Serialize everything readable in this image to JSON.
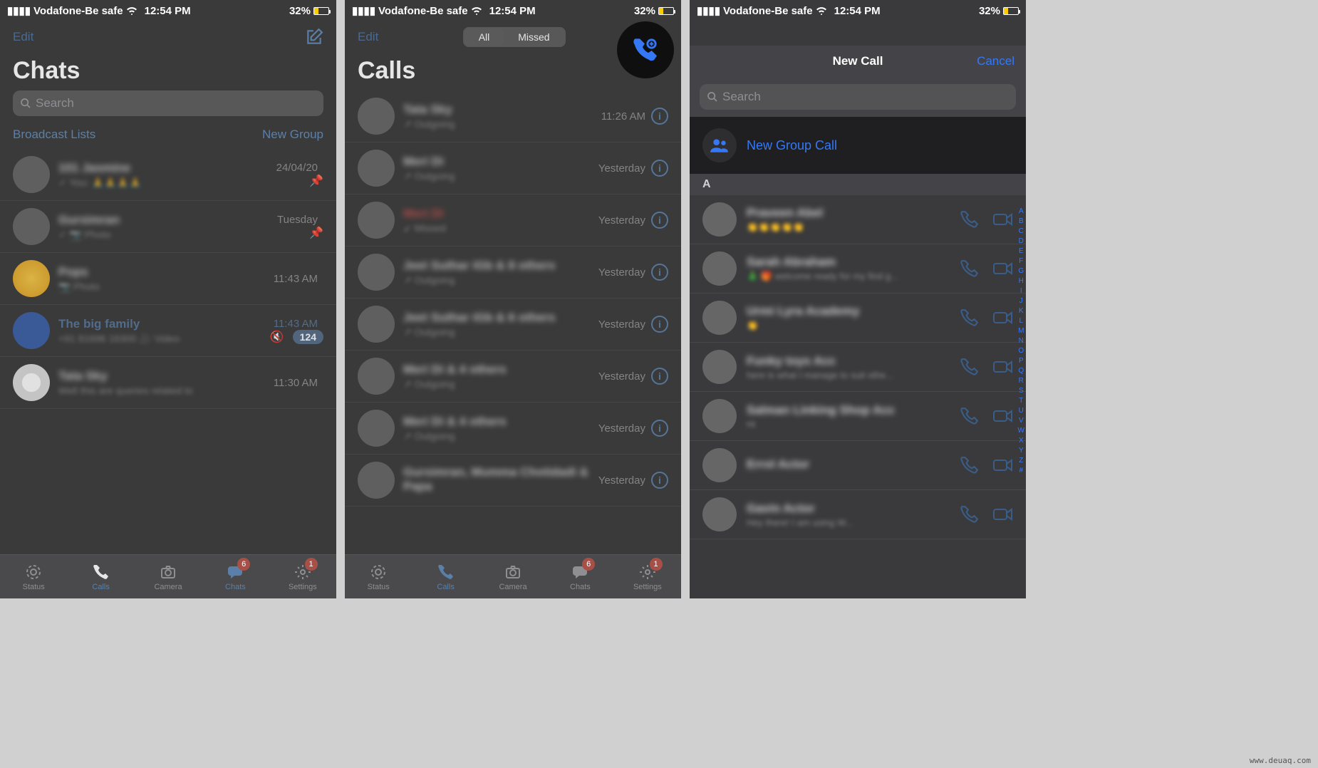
{
  "status": {
    "carrier": "Vodafone-Be safe",
    "time": "12:54 PM",
    "battery_pct": "32%"
  },
  "screen1": {
    "edit": "Edit",
    "title": "Chats",
    "search_ph": "Search",
    "broadcast": "Broadcast Lists",
    "newgroup": "New Group",
    "chats": [
      {
        "name": "101 Jasmine",
        "sub": "✓ You: 🙏🙏🙏🙏",
        "time": "24/04/20",
        "pinned": true
      },
      {
        "name": "Gursimran",
        "sub": "✓ 📷 Photo",
        "time": "Tuesday",
        "pinned": true
      },
      {
        "name": "Pops",
        "sub": "📷 Photo",
        "time": "11:43 AM"
      },
      {
        "name": "The big family",
        "sub": "+91 81696 16300  🎥 Video",
        "time": "11:43 AM",
        "muted": true,
        "badge": "124"
      },
      {
        "name": "Tata Sky",
        "sub": "Well this are queries related to",
        "time": "11:30 AM"
      }
    ],
    "tabs": {
      "status": "Status",
      "calls": "Calls",
      "camera": "Camera",
      "chats": "Chats",
      "settings": "Settings",
      "chats_badge": "6",
      "settings_badge": "1"
    }
  },
  "screen2": {
    "edit": "Edit",
    "title": "Calls",
    "seg_all": "All",
    "seg_missed": "Missed",
    "calls": [
      {
        "name": "Tata Sky",
        "sub": "↗ Outgoing",
        "time": "11:26 AM"
      },
      {
        "name": "Meri Di",
        "sub": "↗ Outgoing",
        "time": "Yesterday"
      },
      {
        "name": "Meri Di",
        "sub": "↙ Missed",
        "time": "Yesterday",
        "missed": true
      },
      {
        "name": "Jeet Suthar iGb & 8 others",
        "sub": "↗ Outgoing",
        "time": "Yesterday"
      },
      {
        "name": "Jeet Suthar iGb & 6 others",
        "sub": "↗ Outgoing",
        "time": "Yesterday"
      },
      {
        "name": "Meri Di & 4 others",
        "sub": "↗ Outgoing",
        "time": "Yesterday"
      },
      {
        "name": "Meri Di & 4 others",
        "sub": "↗ Outgoing",
        "time": "Yesterday"
      },
      {
        "name": "Gursimran, Mumma Chotidadi & Papa",
        "sub": "",
        "time": "Yesterday"
      }
    ],
    "tabs": {
      "status": "Status",
      "calls": "Calls",
      "camera": "Camera",
      "chats": "Chats",
      "settings": "Settings",
      "chats_badge": "6",
      "settings_badge": "1"
    }
  },
  "screen3": {
    "title": "New Call",
    "cancel": "Cancel",
    "search_ph": "Search",
    "group": "New Group Call",
    "section": "A",
    "contacts": [
      {
        "name": "Praveen Abel",
        "sub": "👏👏👏👏👏"
      },
      {
        "name": "Sarah Abraham",
        "sub": "🎄 🎁 welcome ready for my find g..."
      },
      {
        "name": "Urmi Lyra Academy",
        "sub": "👏"
      },
      {
        "name": "Funky toys Acc",
        "sub": "here is what I manage to suit othe..."
      },
      {
        "name": "Salman Linking Shop Acc",
        "sub": "Hi"
      },
      {
        "name": "Errol Actor",
        "sub": ""
      },
      {
        "name": "Gavin Actor",
        "sub": "Hey there! I am using W..."
      }
    ],
    "index": [
      "A",
      "B",
      "C",
      "D",
      "E",
      "F",
      "G",
      "H",
      "I",
      "J",
      "K",
      "L",
      "M",
      "N",
      "O",
      "P",
      "Q",
      "R",
      "S",
      "T",
      "U",
      "V",
      "W",
      "X",
      "Y",
      "Z",
      "#"
    ]
  },
  "watermark": "www.deuaq.com"
}
